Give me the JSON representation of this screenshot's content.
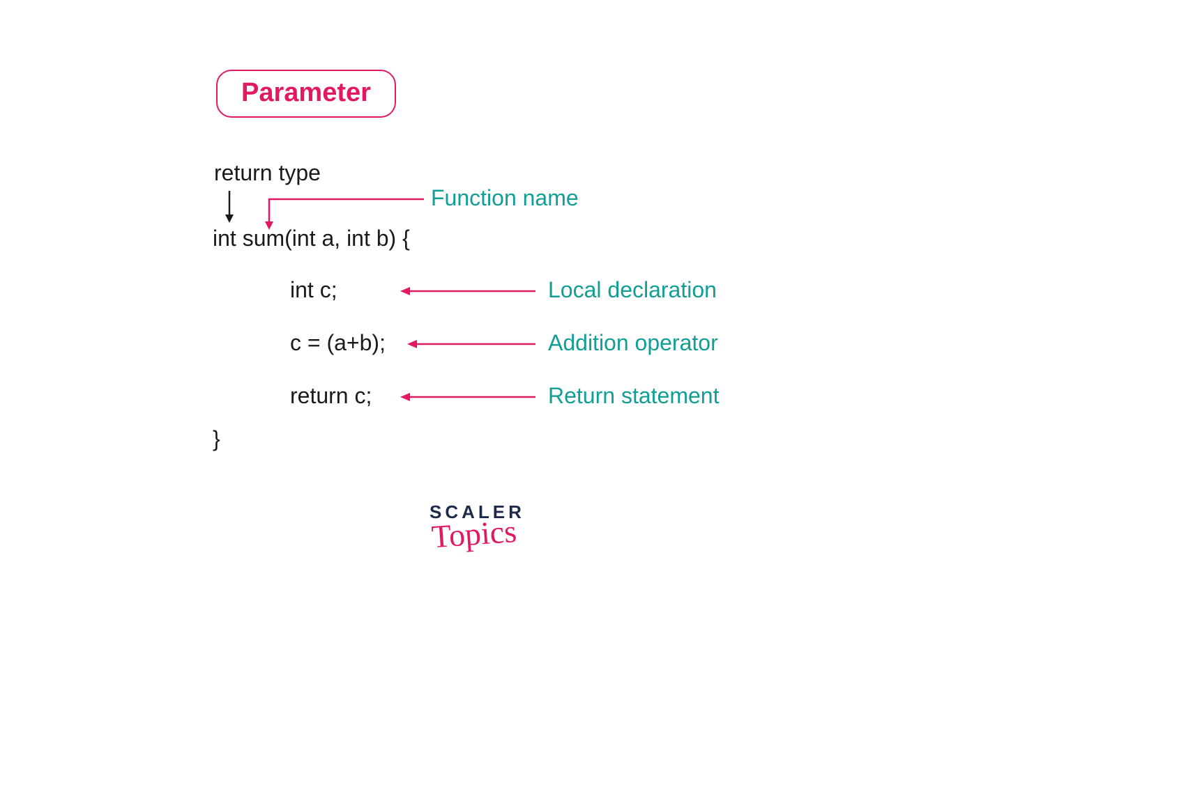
{
  "box_label": "Parameter",
  "code": {
    "return_type_label": "return type",
    "signature": "int sum(int a, int b) {",
    "line_decl": "int c;",
    "line_add": "c = (a+b);",
    "line_ret": "return c;",
    "close": "}"
  },
  "annotations": {
    "func_name": "Function name",
    "local_decl": "Local declaration",
    "addition": "Addition operator",
    "return_stmt": "Return statement"
  },
  "logo": {
    "top": "SCALER",
    "bottom": "Topics"
  },
  "colors": {
    "pink": "#e31863",
    "teal": "#119e94",
    "black": "#1a1a1a"
  }
}
